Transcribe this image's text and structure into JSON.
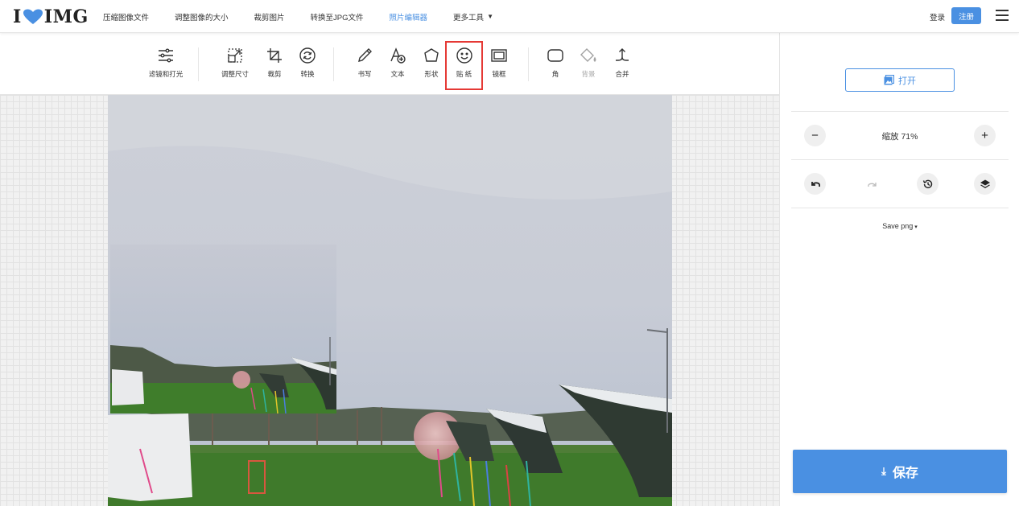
{
  "header": {
    "logo_left": "I",
    "logo_right": "IMG",
    "nav": [
      {
        "label": "压缩图像文件"
      },
      {
        "label": "调整图像的大小"
      },
      {
        "label": "裁剪图片"
      },
      {
        "label": "转换至JPG文件"
      },
      {
        "label": "照片编辑器",
        "active": true
      },
      {
        "label": "更多工具"
      }
    ],
    "login_label": "登录",
    "signup_label": "注册"
  },
  "toolbar": {
    "filters": "滤镜和打光",
    "resize": "调整尺寸",
    "crop": "裁剪",
    "transform": "转换",
    "draw": "书写",
    "text": "文本",
    "shape": "形状",
    "sticker": "贴 纸",
    "frame": "镜框",
    "corner": "角",
    "background": "背景",
    "merge": "合并"
  },
  "panel": {
    "open_label": "打开",
    "zoom_label": "缩放 71%",
    "save_format": "Save png",
    "save_label": "保存"
  },
  "colors": {
    "accent": "#4a90e2",
    "highlight": "#e53935",
    "logo_heart": "#4a90e2"
  }
}
